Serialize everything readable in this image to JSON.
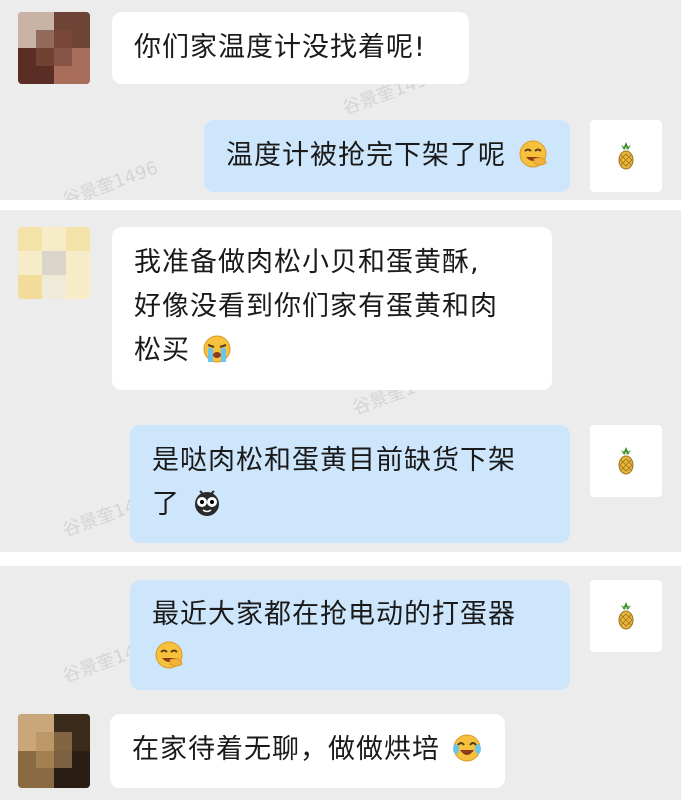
{
  "watermark_text": "谷景奎1496",
  "colors": {
    "panel_bg": "#ececec",
    "incoming_bubble": "#ffffff",
    "outgoing_bubble": "#cde6fb",
    "text": "#1a1a1a"
  },
  "sections": [
    {
      "messages": [
        {
          "side": "incoming",
          "text": "你们家温度计没找着呢!",
          "emoji": ""
        },
        {
          "side": "outgoing",
          "text": "温度计被抢完下架了呢",
          "emoji": "facepalm-laugh-emoji"
        }
      ]
    },
    {
      "messages": [
        {
          "side": "incoming",
          "line1": "我准备做肉松小贝和蛋黄酥,",
          "line2": "好像没看到你们家有蛋黄和肉",
          "line3": "松买",
          "emoji": "crying-emoji"
        },
        {
          "side": "outgoing",
          "line1": "是哒肉松和蛋黄目前缺货下架",
          "line2": "了",
          "emoji": "bug-eyes-emoji"
        }
      ]
    },
    {
      "messages": [
        {
          "side": "outgoing",
          "line1": "最近大家都在抢电动的打蛋器",
          "emoji": "facepalm-laugh-emoji"
        },
        {
          "side": "incoming",
          "text": "在家待着无聊，做做烘培",
          "emoji": "tears-of-joy-emoji"
        }
      ]
    }
  ],
  "self_avatar_icon": "pineapple-icon"
}
